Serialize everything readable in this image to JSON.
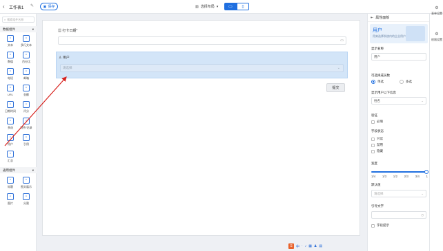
{
  "header": {
    "back_icon": "chevron-left-icon",
    "title": "工作表1",
    "save_label": "保存",
    "layout_label": "选择布局",
    "device_pc_icon": "monitor-icon",
    "device_mobile_icon": "mobile-icon"
  },
  "left_panel": {
    "search_placeholder": "搜索组件名称",
    "data_group_label": "数据组件",
    "data_components": [
      {
        "label": "文本",
        "icon": "text-icon"
      },
      {
        "label": "多行文本",
        "icon": "multiline-text-icon"
      },
      {
        "label": "数值",
        "icon": "number-icon"
      },
      {
        "label": "百分比",
        "icon": "percent-icon"
      },
      {
        "label": "电话",
        "icon": "phone-icon"
      },
      {
        "label": "邮箱",
        "icon": "email-icon"
      },
      {
        "label": "URL",
        "icon": "link-icon"
      },
      {
        "label": "金额",
        "icon": "money-icon"
      },
      {
        "label": "日期时间",
        "icon": "datetime-icon"
      },
      {
        "label": "评分",
        "icon": "rating-icon"
      },
      {
        "label": "多选",
        "icon": "multi-select-icon"
      },
      {
        "label": "附件/记录",
        "icon": "attachment-icon"
      },
      {
        "label": "用户",
        "icon": "user-icon"
      },
      {
        "label": "引用",
        "icon": "reference-icon"
      },
      {
        "label": "汇总",
        "icon": "summary-icon"
      }
    ],
    "common_group_label": "通用组件",
    "common_components": [
      {
        "label": "标题",
        "icon": "heading-icon"
      },
      {
        "label": "图文展示",
        "icon": "image-text-icon"
      },
      {
        "label": "图片",
        "icon": "image-icon"
      },
      {
        "label": "分割",
        "icon": "divider-icon"
      }
    ]
  },
  "canvas": {
    "date_field_label": "打卡日期*",
    "user_field_label": "用户",
    "user_field_placeholder": "请选择",
    "submit_label": "提交"
  },
  "bottom_tools": [
    "S",
    "中",
    "·",
    "♪",
    "▦",
    "♟",
    "▤"
  ],
  "right_panel": {
    "header": "属性面板",
    "banner_title": "用户",
    "banner_desc": "用来选择系统内的企业用户",
    "display_name_label": "显示名称",
    "display_name_value": "用户",
    "select_count_label": "可选择成员数",
    "radio_single": "单选",
    "radio_multi": "多选",
    "scope_label": "显示用户以下信息",
    "scope_value": "姓名",
    "verify_label": "验证",
    "required_label": "必填",
    "field_status_label": "字段状态",
    "status_options": [
      "只读",
      "禁用",
      "隐藏"
    ],
    "width_label": "宽度",
    "width_ticks": [
      "1/4",
      "1/3",
      "1/2",
      "2/3",
      "3/4",
      "1"
    ],
    "default_label": "默认值",
    "default_placeholder": "请选择",
    "hint_label": "引导文字",
    "hint_placeholder": "",
    "tooltip_label": "字段提示"
  },
  "far_right": [
    {
      "label": "表单设置",
      "icon": "form-settings-icon"
    },
    {
      "label": "权限设置",
      "icon": "permission-settings-icon"
    }
  ],
  "colors": {
    "accent": "#1f6fe0",
    "selected_field": "#d3e5f8",
    "arrow": "#d8231f"
  }
}
